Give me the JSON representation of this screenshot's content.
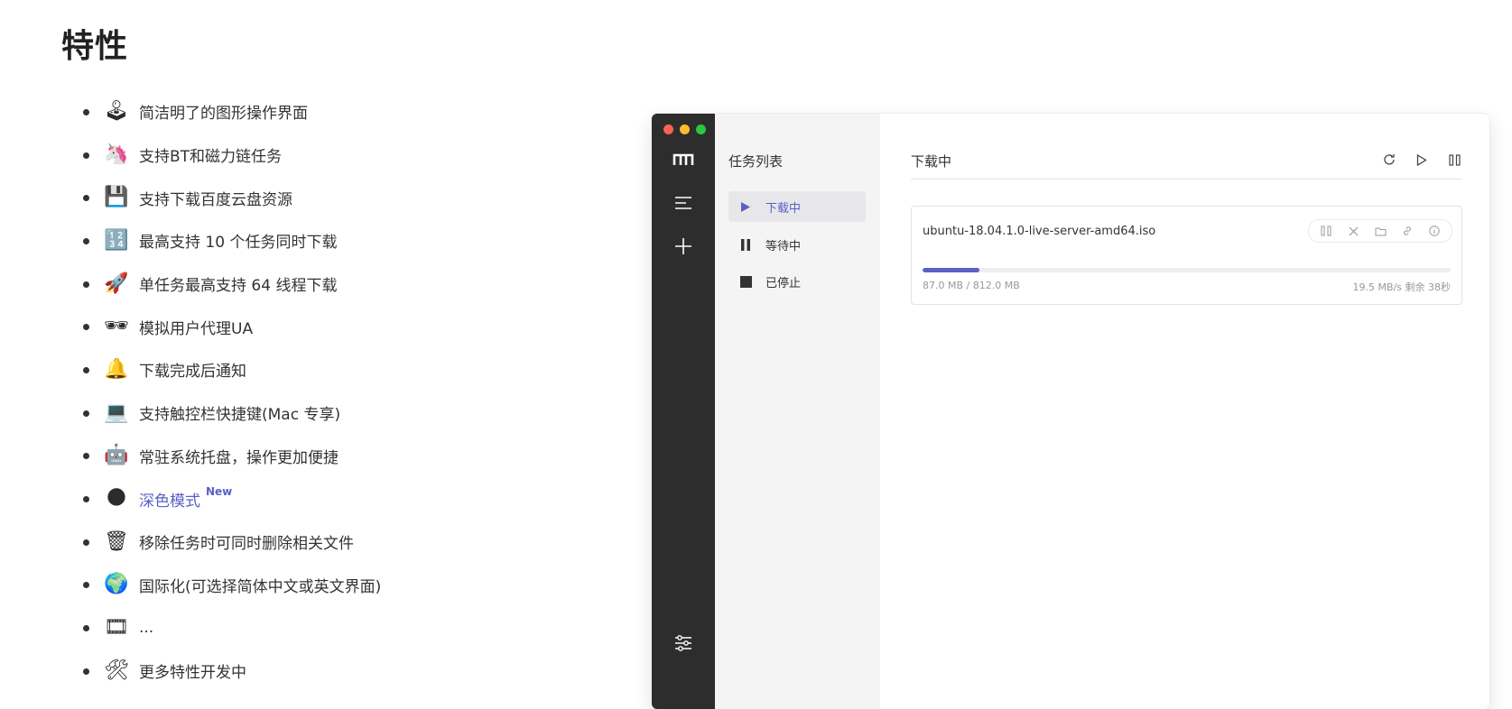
{
  "section_title": "特性",
  "features": [
    {
      "icon": "joystick-icon",
      "glyph": "🕹",
      "text": "简洁明了的图形操作界面"
    },
    {
      "icon": "unicorn-icon",
      "glyph": "🦄",
      "text": "支持BT和磁力链任务"
    },
    {
      "icon": "floppy-disk-icon",
      "glyph": "💾",
      "text": "支持下载百度云盘资源"
    },
    {
      "icon": "numbers-icon",
      "glyph": "🔢",
      "text": "最高支持 10 个任务同时下载"
    },
    {
      "icon": "rocket-icon",
      "glyph": "🚀",
      "text": "单任务最高支持 64 线程下载"
    },
    {
      "icon": "sunglasses-icon",
      "glyph": "🕶",
      "text": "模拟用户代理UA"
    },
    {
      "icon": "bell-icon",
      "glyph": "🔔",
      "text": "下载完成后通知"
    },
    {
      "icon": "laptop-icon",
      "glyph": "💻",
      "text": "支持触控栏快捷键(Mac 专享)"
    },
    {
      "icon": "robot-icon",
      "glyph": "🤖",
      "text": "常驻系统托盘，操作更加便捷"
    },
    {
      "icon": "moon-icon",
      "glyph": "🌑",
      "text": "深色模式",
      "badge": "New",
      "link": true
    },
    {
      "icon": "trash-icon",
      "glyph": "🗑",
      "text": "移除任务时可同时删除相关文件"
    },
    {
      "icon": "globe-icon",
      "glyph": "🌍",
      "text": "国际化(可选择简体中文或英文界面)"
    },
    {
      "icon": "film-frames-icon",
      "glyph": "🎞",
      "text": "..."
    },
    {
      "icon": "hammer-wrench-icon",
      "glyph": "🛠",
      "text": "更多特性开发中"
    }
  ],
  "app": {
    "panel_title": "任务列表",
    "nav": [
      {
        "label": "下载中",
        "icon": "play-icon",
        "active": true
      },
      {
        "label": "等待中",
        "icon": "pause-icon",
        "active": false
      },
      {
        "label": "已停止",
        "icon": "stop-icon",
        "active": false
      }
    ],
    "pane_title": "下载中",
    "task": {
      "name": "ubuntu-18.04.1.0-live-server-amd64.iso",
      "size": "87.0 MB / 812.0 MB",
      "speed": "19.5 MB/s 剩余 38秒",
      "progress": 0.107
    },
    "accent_color": "#5b5fc7"
  }
}
